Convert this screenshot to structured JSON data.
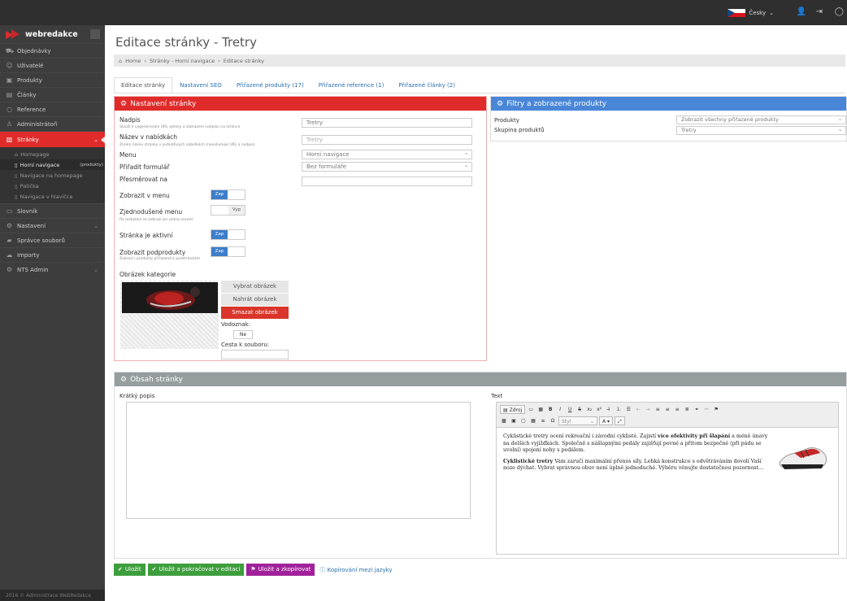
{
  "topbar": {
    "language": "Česky"
  },
  "brand": {
    "name": "webredakce"
  },
  "sidebar": {
    "items": [
      {
        "label": "Objednávky",
        "icon": "cart-icon"
      },
      {
        "label": "Uživatelé",
        "icon": "users-icon"
      },
      {
        "label": "Produkty",
        "icon": "box-icon"
      },
      {
        "label": "Články",
        "icon": "article-icon"
      },
      {
        "label": "Reference",
        "icon": "circle-icon"
      },
      {
        "label": "Administrátoři",
        "icon": "user-icon"
      },
      {
        "label": "Stránky",
        "icon": "pages-icon"
      }
    ],
    "subitems": [
      {
        "label": "Homepage"
      },
      {
        "label": "Horní navigace",
        "tag": "(produkty)"
      },
      {
        "label": "Navigace na homepage"
      },
      {
        "label": "Patička"
      },
      {
        "label": "Navigace v hlavičce"
      }
    ],
    "items2": [
      {
        "label": "Slovník"
      },
      {
        "label": "Nastavení"
      },
      {
        "label": "Správce souborů"
      },
      {
        "label": "Importy"
      },
      {
        "label": "NTS Admin"
      }
    ],
    "copyright": "2016 © Administrace WebRedakce"
  },
  "page": {
    "title": "Editace stránky - Tretry",
    "breadcrumb": [
      "Home",
      "Stránky - Horní navigace",
      "Editace stránky"
    ]
  },
  "tabs": [
    "Editace stránky",
    "Nastavení SEO",
    "Přiřazené produkty (17)",
    "Přiřazené reference (1)",
    "Přiřazené články (2)"
  ],
  "settings": {
    "title": "Nastavení stránky",
    "nadpis_label": "Nadpis",
    "nadpis_hint": "Slouží k vygenerování URL adresy a zobrazení nadpisu na stránce",
    "nadpis_value": "Tretry",
    "nazev_label": "Název v nabídkách",
    "nazev_hint": "Změní název stránky v jednotlivých nabídkách (neovlivňuje URL a nadpis)",
    "nazev_placeholder": "Tretry",
    "menu_label": "Menu",
    "menu_value": "Horní navigace",
    "form_label": "Přiřadit formulář",
    "form_value": "Bez formuláře",
    "redirect_label": "Přesměrovat na",
    "show_menu_label": "Zobrazit v menu",
    "simple_menu_label": "Zjednodušené menu",
    "simple_menu_hint": "Po rozbalení se zobrazí jen jedna úroveň",
    "active_label": "Stránka je aktivní",
    "subproducts_label": "Zobrazit podprodukty",
    "subproducts_hint": "Zobrazí i produkty přiřazené k podstránkám",
    "toggle_on": "Zap",
    "toggle_off": "Vyp",
    "image_label": "Obrázek kategorie",
    "choose_image": "Vybrat obrázek",
    "upload_image": "Nahrát obrázek",
    "delete_image": "Smazat obrázek",
    "watermark_label": "Vodoznak:",
    "watermark_value": "Ne",
    "path_label": "Cesta k souboru:"
  },
  "filters": {
    "title": "Filtry a zobrazené produkty",
    "products_label": "Produkty",
    "products_value": "Zobrazit všechny přiřazené produkty",
    "group_label": "Skupina produktů",
    "group_value": "Tretry"
  },
  "content": {
    "title": "Obsah stránky",
    "short_label": "Krátký popis",
    "text_label": "Text",
    "rte_source": "Zdroj",
    "rte_style": "Styl",
    "p1_a": "Cyklistické tretry ocení rekreační i závodní cyklisté. Zajistí ",
    "p1_b": "více efektivity při šlapání",
    "p1_c": " a méně únavy na delších vyjížďkách. Společně s nášlapnými pedály zajišťují pevné a přitom bezpečné (při pádu se uvolní) spojení nohy s pedálem.",
    "p2_a": "Cyklistické tretry",
    "p2_b": " Vám zaručí maximální přenos síly. Lehká konstrukce s odvětráváním dovolí Vaší noze dýchat. Vybrat správnou obuv není úplně jednoduché. Výběru věnujte dostatečnou pozornost…"
  },
  "actions": {
    "save": "Uložit",
    "save_continue": "Uložit a pokračovat v editaci",
    "save_copy": "Uložit a zkopírovat",
    "copy_lang": "Kopírování mezi jazyky"
  }
}
